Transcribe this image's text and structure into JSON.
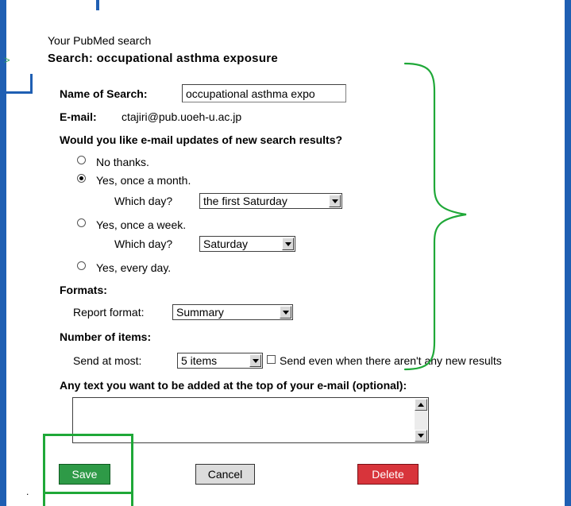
{
  "header": {
    "small_title": "Your PubMed search",
    "search_title": "Search: occupational asthma exposure"
  },
  "form": {
    "name_label": "Name of Search:",
    "name_value": "occupational asthma expo",
    "email_label": "E-mail:",
    "email_value": "ctajiri@pub.uoeh-u.ac.jp",
    "updates_question": "Would you like e-mail updates of new search results?",
    "options": {
      "none": "No thanks.",
      "monthly": "Yes, once a month.",
      "weekly": "Yes, once a week.",
      "daily": "Yes, every day."
    },
    "selected_option": "monthly",
    "which_day_label": "Which day?",
    "monthly_day": "the first Saturday",
    "weekly_day": "Saturday",
    "formats_heading": "Formats:",
    "report_format_label": "Report format:",
    "report_format_value": "Summary",
    "items_heading": "Number of items:",
    "send_at_most_label": "Send at most:",
    "send_at_most_value": "5 items",
    "send_even_label": "Send even when there aren't any new results",
    "send_even_checked": false,
    "extra_text_label": "Any text you want to be added at the top of your e-mail (optional):",
    "extra_text_value": ""
  },
  "buttons": {
    "save": "Save",
    "cancel": "Cancel",
    "delete": "Delete"
  },
  "colors": {
    "frame": "#1f5fb3",
    "highlight": "#1fa838",
    "save": "#2e9a47",
    "delete": "#d8343b"
  }
}
